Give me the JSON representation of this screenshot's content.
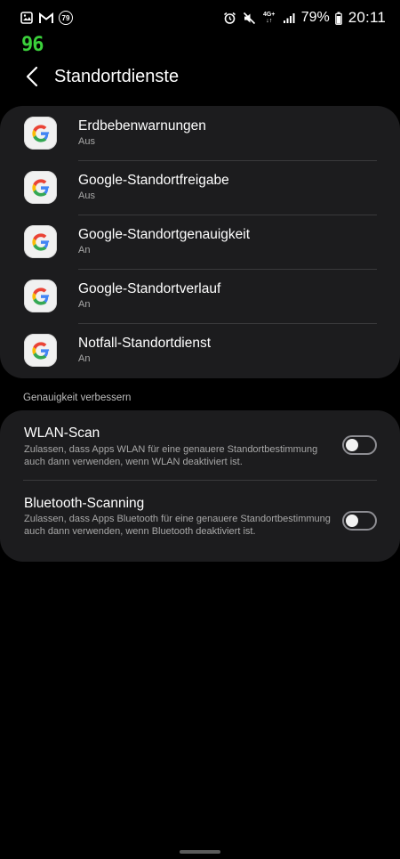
{
  "statusbar": {
    "notification_badge": "79",
    "network_label_top": "4G+",
    "network_label_bottom": "↓↑",
    "battery_percent": "79%",
    "time": "20:11",
    "left_icons": [
      "gallery-icon",
      "gmail-icon",
      "badge-79"
    ],
    "right_icons": [
      "alarm-icon",
      "mute-icon",
      "4g-icon",
      "signal-icon",
      "battery-icon"
    ]
  },
  "overlay": {
    "fps": "96"
  },
  "header": {
    "title": "Standortdienste"
  },
  "services": [
    {
      "title": "Erdbebenwarnungen",
      "status": "Aus",
      "icon": "google-icon"
    },
    {
      "title": "Google-Standortfreigabe",
      "status": "Aus",
      "icon": "google-icon"
    },
    {
      "title": "Google-Standortgenauigkeit",
      "status": "An",
      "icon": "google-icon"
    },
    {
      "title": "Google-Standortverlauf",
      "status": "An",
      "icon": "google-icon"
    },
    {
      "title": "Notfall-Standortdienst",
      "status": "An",
      "icon": "google-icon"
    }
  ],
  "section_label": "Genauigkeit verbessern",
  "toggles": [
    {
      "title": "WLAN-Scan",
      "description": "Zulassen, dass Apps WLAN für eine genauere Standortbestimmung auch dann verwenden, wenn WLAN deaktiviert ist.",
      "state": "off"
    },
    {
      "title": "Bluetooth-Scanning",
      "description": "Zulassen, dass Apps Bluetooth für eine genauere Standortbestimmung auch dann verwenden, wenn Bluetooth deaktiviert ist.",
      "state": "off"
    }
  ],
  "colors": {
    "background": "#000000",
    "card": "#1c1c1e",
    "fps_overlay": "#3bd13b"
  }
}
